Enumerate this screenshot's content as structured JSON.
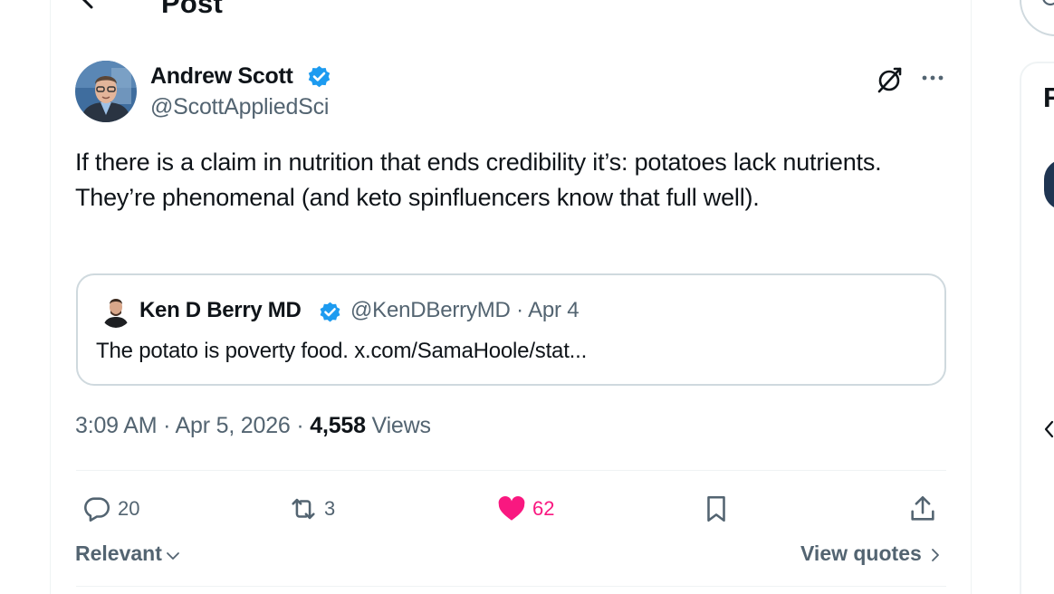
{
  "header": {
    "title": "Post"
  },
  "post": {
    "author_name": "Andrew Scott",
    "author_handle": "@ScottAppliedSci",
    "text": "If there is a claim in nutrition that ends credibility it’s: potatoes lack nutrients. They’re phenomenal (and keto spinfluencers know that full well).",
    "quote": {
      "author_name": "Ken D Berry MD",
      "author_handle_date": "@KenDBerryMD · Apr 4",
      "text": "The potato is poverty food. x.com/SamaHoole/stat..."
    },
    "time_date": "3:09 AM · Apr 5, 2026 · ",
    "views_count": "4,558",
    "views_label": " Views",
    "stats": {
      "replies": "20",
      "reposts": "3",
      "likes": "62"
    },
    "sort_label": "Relevant",
    "view_quotes_label": "View quotes"
  },
  "sidebar": {
    "heading_fragment": "R"
  },
  "colors": {
    "verified_blue": "#1d9bf0",
    "like_pink": "#f91880",
    "muted_text": "#536471",
    "border": "#cfd9de"
  },
  "icons": [
    "back-arrow-icon",
    "verified-icon",
    "grok-icon",
    "more-icon",
    "reply-icon",
    "repost-icon",
    "like-icon",
    "bookmark-icon",
    "share-icon",
    "chevron-down-icon",
    "chevron-right-icon",
    "search-icon"
  ]
}
